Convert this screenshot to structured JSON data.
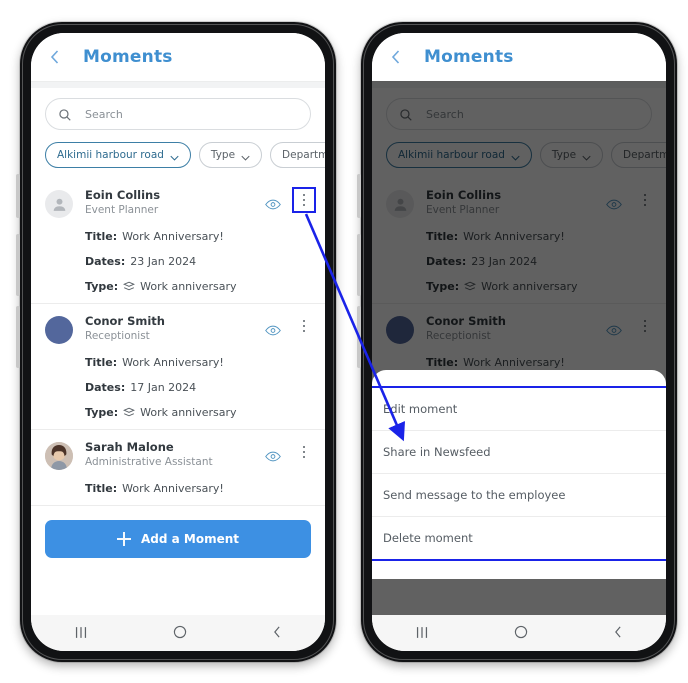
{
  "app": {
    "title": "Moments",
    "back_icon": "chevron-left-icon",
    "accent_color": "#3f8fd0",
    "highlight_color": "#1a23e8",
    "primary_button_color": "#3d90e3"
  },
  "search": {
    "placeholder": "Search",
    "icon": "search-icon"
  },
  "filters": [
    {
      "label": "Alkimii harbour road",
      "icon": "chevron-down-icon",
      "selected": true
    },
    {
      "label": "Type",
      "icon": "chevron-down-icon",
      "selected": false
    },
    {
      "label": "Department",
      "icon": "chevron-down-icon",
      "selected": false
    }
  ],
  "moments": [
    {
      "name": "Eoin Collins",
      "role": "Event Planner",
      "avatar": "person-placeholder-avatar",
      "title_label": "Title:",
      "title_value": "Work Anniversary!",
      "dates_label": "Dates:",
      "dates_value": "23 Jan 2024",
      "type_label": "Type:",
      "type_icon": "stack-icon",
      "type_value": "Work anniversary",
      "view_icon": "eye-icon",
      "menu_icon": "kebab-menu-icon"
    },
    {
      "name": "Conor Smith",
      "role": "Receptionist",
      "avatar": "blue-initial-avatar",
      "title_label": "Title:",
      "title_value": "Work Anniversary!",
      "dates_label": "Dates:",
      "dates_value": "17 Jan 2024",
      "type_label": "Type:",
      "type_icon": "stack-icon",
      "type_value": "Work anniversary",
      "view_icon": "eye-icon",
      "menu_icon": "kebab-menu-icon"
    },
    {
      "name": "Sarah Malone",
      "role": "Administrative Assistant",
      "avatar": "photo-avatar",
      "title_label": "Title:",
      "title_value": "Work Anniversary!",
      "view_icon": "eye-icon",
      "menu_icon": "kebab-menu-icon"
    }
  ],
  "add_button": {
    "label": "Add a Moment",
    "icon": "plus-icon"
  },
  "context_menu": {
    "items": [
      {
        "label": "Edit moment"
      },
      {
        "label": "Share in Newsfeed"
      },
      {
        "label": "Send message to the employee"
      },
      {
        "label": "Delete moment"
      }
    ]
  },
  "android_nav": {
    "recents_icon": "recents-icon",
    "home_icon": "home-icon",
    "back_icon": "back-icon"
  },
  "annotation": {
    "arrow": "blue-arrow-from-kebab-to-context-menu",
    "highlight_boxes": [
      "kebab-menu-icon",
      "context-menu-list"
    ]
  }
}
